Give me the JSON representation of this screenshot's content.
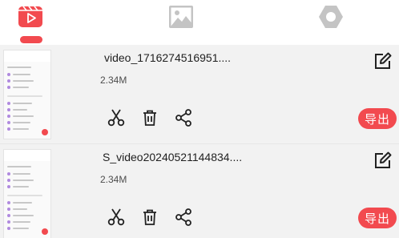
{
  "tabs": [
    {
      "icon": "video-icon",
      "active": true
    },
    {
      "icon": "image-icon",
      "active": false
    },
    {
      "icon": "settings-icon",
      "active": false
    }
  ],
  "colors": {
    "accent": "#f24a4f",
    "inactive_icon": "#c4c4c4",
    "row_background": "#f2f2f2",
    "action_icon": "#222222"
  },
  "videos": [
    {
      "filename": "video_1716274516951....",
      "size": "2.34M",
      "export_label": "导出",
      "actions": [
        "scissors-icon",
        "trash-icon",
        "share-icon",
        "edit-icon"
      ]
    },
    {
      "filename": "S_video20240521144834....",
      "size": "2.34M",
      "export_label": "导出",
      "actions": [
        "scissors-icon",
        "trash-icon",
        "share-icon",
        "edit-icon"
      ]
    }
  ]
}
